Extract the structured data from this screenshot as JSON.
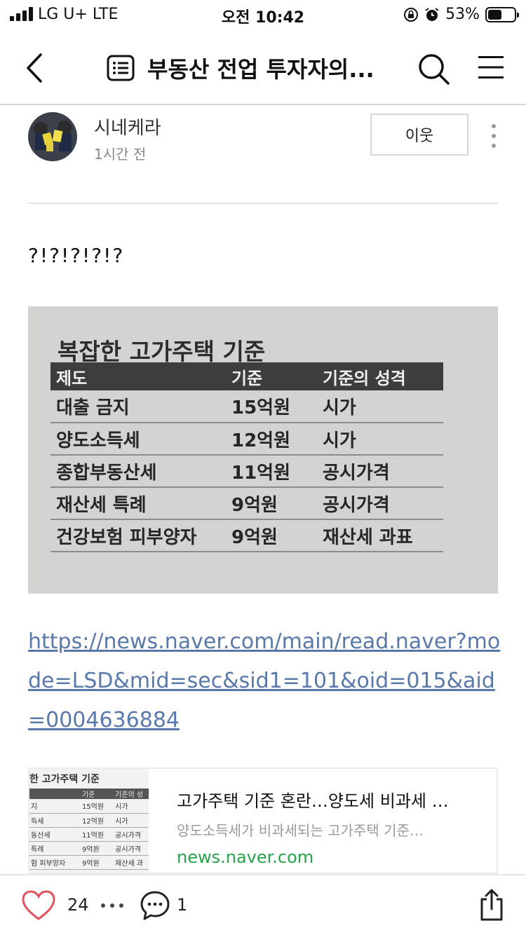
{
  "status_bar": {
    "carrier": "LG U+  LTE",
    "time": "오전 10:42",
    "battery": "53%",
    "battery_level": 0.53
  },
  "nav": {
    "title": "부동산 전업 투자자의..."
  },
  "post": {
    "author": "시네케라",
    "time_ago": "1시간 전",
    "follow_label": "이웃",
    "body": "?!?!?!?!?",
    "image": {
      "title": "복잡한 고가주택 기준",
      "headers": [
        "제도",
        "기준",
        "기준의 성격"
      ],
      "rows": [
        [
          "대출 금지",
          "15억원",
          "시가"
        ],
        [
          "양도소득세",
          "12억원",
          "시가"
        ],
        [
          "종합부동산세",
          "11억원",
          "공시가격"
        ],
        [
          "재산세 특례",
          "9억원",
          "공시가격"
        ],
        [
          "건강보험 피부양자",
          "9억원",
          "재산세 과표"
        ]
      ]
    },
    "link": "https://news.naver.com/main/read.naver?mode=LSD&mid=sec&sid1=101&oid=015&aid=0004636884",
    "card": {
      "thumb_title": "한 고가주택 기준",
      "thumb_headers": [
        "",
        "기준",
        "기준의 성"
      ],
      "thumb_rows": [
        [
          "지",
          "15억원",
          "시가"
        ],
        [
          "득세",
          "12억원",
          "시가"
        ],
        [
          "동산세",
          "11억원",
          "공시가격"
        ],
        [
          "특례",
          "9억원",
          "공시가격"
        ],
        [
          "험 피부양자",
          "9억원",
          "재산세 과"
        ]
      ],
      "title": "고가주택 기준 혼란…양도세 비과세 …",
      "description": "양도소득세가 비과세되는 고가주택 기준…",
      "domain": "news.naver.com"
    }
  },
  "bottom_bar": {
    "likes": "24",
    "comments": "1"
  },
  "colors": {
    "link": "#5a79ab",
    "domain": "#27a34b",
    "heart": "#e0525e"
  }
}
